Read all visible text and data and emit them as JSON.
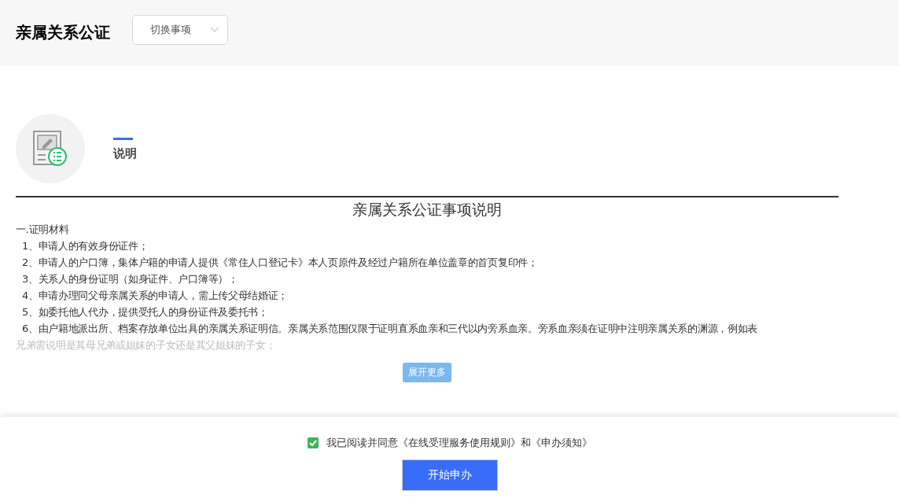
{
  "header": {
    "title": "亲属关系公证",
    "switcher": {
      "value": "切换事项"
    }
  },
  "tabs": [
    {
      "label": "说明",
      "selected": true
    }
  ],
  "document": {
    "title": "亲属关系公证事项说明",
    "section": "一.证明材料",
    "items": [
      "1、申请人的有效身份证件；",
      "2、申请人的户口簿，集体户籍的申请人提供《常住人口登记卡》本人页原件及经过户籍所在单位盖章的首页复印件；",
      "3、关系人的身份证明（如身证件、户口簿等）；",
      "4、申请办理同父母亲属关系的申请人，需上传父母结婚证；",
      "5、如委托他人代办，提供受托人的身份证件及委托书；",
      "6、由户籍地派出所、档案存放单位出具的亲属关系证明信。亲属关系范围仅限于证明直系血亲和三代以内旁系血亲。旁系血亲须在证明中注明亲属关系的渊源，例如表"
    ],
    "faded_line": "兄弟需说明是其母兄弟或姐妹的子女还是其父姐妹的子女；",
    "expand_button": "展开更多"
  },
  "footer": {
    "agreement": {
      "checked": true,
      "text": "我已阅读并同意《在线受理服务使用规则》和《申办须知》"
    },
    "start_button": "开始申办"
  }
}
